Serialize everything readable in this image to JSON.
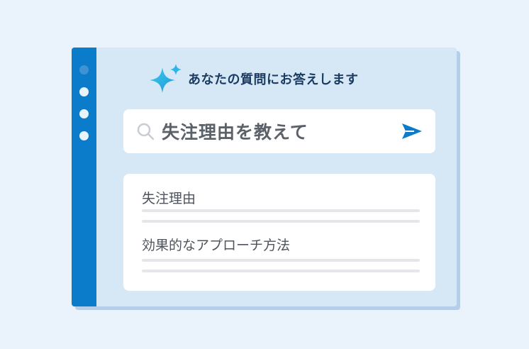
{
  "header": {
    "title": "あなたの質問にお答えします",
    "icon": "sparkle-icon",
    "icon_color": "#2bb5e8"
  },
  "search": {
    "query": "失注理由を教えて",
    "search_icon": "search-icon",
    "send_icon": "send-icon",
    "send_color": "#0a7cc9"
  },
  "results": {
    "items": [
      {
        "label": "失注理由"
      },
      {
        "label": "効果的なアプローチ方法"
      }
    ]
  },
  "colors": {
    "sidebar": "#0a7cc9",
    "background": "#eaf3fb",
    "window": "#d6e8f5"
  }
}
